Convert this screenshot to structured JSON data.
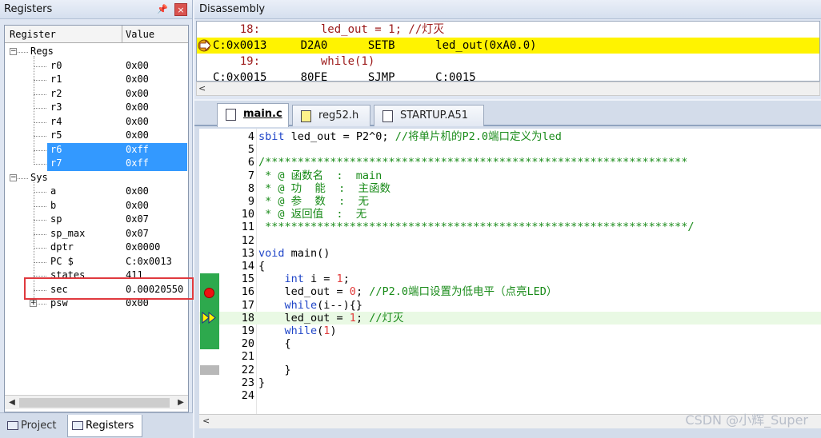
{
  "registers_pane": {
    "title": "Registers",
    "pin_glyph": "ᵖ",
    "close_glyph": "×",
    "columns": {
      "register": "Register",
      "value": "Value"
    },
    "groups": {
      "regs": {
        "label": "Regs",
        "items": [
          {
            "name": "r0",
            "value": "0x00"
          },
          {
            "name": "r1",
            "value": "0x00"
          },
          {
            "name": "r2",
            "value": "0x00"
          },
          {
            "name": "r3",
            "value": "0x00"
          },
          {
            "name": "r4",
            "value": "0x00"
          },
          {
            "name": "r5",
            "value": "0x00"
          },
          {
            "name": "r6",
            "value": "0xff",
            "selected": true
          },
          {
            "name": "r7",
            "value": "0xff",
            "selected": true
          }
        ]
      },
      "sys": {
        "label": "Sys",
        "items": [
          {
            "name": "a",
            "value": "0x00"
          },
          {
            "name": "b",
            "value": "0x00"
          },
          {
            "name": "sp",
            "value": "0x07"
          },
          {
            "name": "sp_max",
            "value": "0x07"
          },
          {
            "name": "dptr",
            "value": "0x0000"
          },
          {
            "name": "PC  $",
            "value": "C:0x0013"
          },
          {
            "name": "states",
            "value": "411"
          },
          {
            "name": "sec",
            "value": "0.00020550",
            "highlighted": true
          },
          {
            "name": "psw",
            "value": "0x00",
            "expandable": true
          }
        ]
      }
    },
    "bottom_tabs": [
      {
        "label": "Project",
        "active": false
      },
      {
        "label": "Registers",
        "active": true
      }
    ]
  },
  "disassembly": {
    "title": "Disassembly",
    "lines": [
      {
        "text": "    18:         led_out = 1; //灯灭",
        "kind": "source"
      },
      {
        "text": "C:0x0013     D2A0      SETB      led_out(0xA0.0)",
        "kind": "current"
      },
      {
        "text": "    19:         while(1)",
        "kind": "source"
      },
      {
        "text": "C:0x0015     80FE      SJMP      C:0015",
        "kind": "asm"
      }
    ]
  },
  "editor": {
    "tabs": [
      {
        "label": "main.c",
        "active": true,
        "icon": "c-file-icon"
      },
      {
        "label": "reg52.h",
        "active": false,
        "icon": "header-file-icon"
      },
      {
        "label": "STARTUP.A51",
        "active": false,
        "icon": "asm-file-icon"
      }
    ],
    "code_lines": [
      {
        "n": "4",
        "t": "sbit led_out = P2^0; //将单片机的P2.0端口定义为led"
      },
      {
        "n": "5",
        "t": ""
      },
      {
        "n": "6",
        "t": "/*****************************************************************"
      },
      {
        "n": "7",
        "t": " * @ 函数名  :  main"
      },
      {
        "n": "8",
        "t": " * @ 功  能  :  主函数"
      },
      {
        "n": "9",
        "t": " * @ 参  数  :  无"
      },
      {
        "n": "10",
        "t": " * @ 返回值  :  无"
      },
      {
        "n": "11",
        "t": " *****************************************************************/"
      },
      {
        "n": "12",
        "t": ""
      },
      {
        "n": "13",
        "t": "void main()"
      },
      {
        "n": "14",
        "t": "{"
      },
      {
        "n": "15",
        "t": "    int i = 1;"
      },
      {
        "n": "16",
        "t": "    led_out = 0; //P2.0端口设置为低电平（点亮LED）"
      },
      {
        "n": "17",
        "t": "    while(i--){}"
      },
      {
        "n": "18",
        "t": "    led_out = 1; //灯灭"
      },
      {
        "n": "19",
        "t": "    while(1)"
      },
      {
        "n": "20",
        "t": "    {"
      },
      {
        "n": "21",
        "t": ""
      },
      {
        "n": "22",
        "t": "    }"
      },
      {
        "n": "23",
        "t": "}"
      },
      {
        "n": "24",
        "t": ""
      }
    ],
    "current_line": "18",
    "breakpoint_line": "16"
  },
  "watermark": "CSDN @小辉_Super",
  "colors": {
    "selection": "#3399ff",
    "current_asm": "#fff300",
    "breakpoint": "#e11",
    "highlight_box": "#e0393e",
    "keyword": "#1f45c8",
    "comment": "#198b19",
    "number": "#e23c3c"
  }
}
